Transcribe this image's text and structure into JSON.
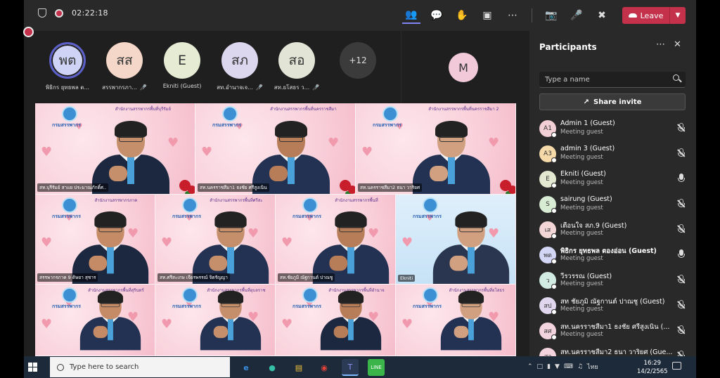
{
  "meeting": {
    "timer": "02:22:18",
    "leave_label": "Leave"
  },
  "avatars": [
    {
      "initials": "พต",
      "name": "พิธิกร ยุทธพล ต...",
      "color": "#cfd4f7",
      "selected": true,
      "mic_off": false
    },
    {
      "initials": "สส",
      "name": "สรรพากรภา...",
      "color": "#f4d7c8",
      "selected": false,
      "mic_off": true
    },
    {
      "initials": "E",
      "name": "Ekniti (Guest)",
      "color": "#e6ebd3",
      "selected": false,
      "mic_off": false
    },
    {
      "initials": "สภ",
      "name": "สท.อำนาจเจ...",
      "color": "#dcd7ef",
      "selected": false,
      "mic_off": true
    },
    {
      "initials": "สอ",
      "name": "สท.ยโสธร ว...",
      "color": "#e2e4d6",
      "selected": false,
      "mic_off": true
    }
  ],
  "overflow_count": "+12",
  "spotlight_initial": "M",
  "video_tiles": [
    {
      "header": "สำนักงานสรรพากรพื้นที่บุรีรัมย์",
      "caption": "สท.บุรีรัมย์ สาแย ประมาณภักดิ์ศ..",
      "blue": false
    },
    {
      "header": "สำนักงานสรรพากรพื้นที่นครราชสีมา",
      "caption": "สท.นครราชสีมา1 ธงชัย ศรีสูงเนิน",
      "blue": false
    },
    {
      "header": "สำนักงานสรรพากรพื้นที่นครราชสีมา 2",
      "caption": "สท.นครราชสีมา2 ธนา วาริยศ",
      "blue": false
    },
    {
      "header": "สำนักงานสรรพากรภาค",
      "caption": "สรรพากรภาค 9 ดิษยา สุชาร",
      "blue": false
    },
    {
      "header": "สำนักงานสรรพากรพื้นที่ศรีสะ",
      "caption": "สท.ศรีสะเกษ เจียรพรรณ์ จิตรัญญา",
      "blue": false
    },
    {
      "header": "สำนักงานสรรพากรพื้นที่",
      "caption": "สท.ชัยภูมิ ณัฐกานต์ ปาณชู",
      "blue": false
    },
    {
      "header": "",
      "caption": "Ekniti",
      "blue": true
    },
    {
      "header": "สำนักงานสรรพากรพื้นที่สุรินทร์",
      "caption": "",
      "blue": false
    },
    {
      "header": "สำนักงานสรรพากรพื้นที่อุบลราช",
      "caption": "",
      "blue": false
    },
    {
      "header": "สำนักงานสรรพากรพื้นที่อำนาจ",
      "caption": "",
      "blue": false
    },
    {
      "header": "สำนักงานสรรพากรพื้นที่ยโสธร",
      "caption": "",
      "blue": false
    }
  ],
  "tile_logo": "กรมสรรพากร",
  "panel": {
    "title": "Participants",
    "search_placeholder": "Type a name",
    "share_label": "Share invite"
  },
  "participants": [
    {
      "initials": "A1",
      "name": "Admin 1 (Guest)",
      "role": "Meeting guest",
      "color": "#f2cfd4",
      "mic": "off",
      "bold": false
    },
    {
      "initials": "A3",
      "name": "admin 3 (Guest)",
      "role": "Meeting guest",
      "color": "#f5d9a8",
      "mic": "off",
      "bold": false
    },
    {
      "initials": "E",
      "name": "Ekniti (Guest)",
      "role": "Meeting guest",
      "color": "#e3e8d0",
      "mic": "on",
      "bold": false
    },
    {
      "initials": "S",
      "name": "sairung (Guest)",
      "role": "Meeting guest",
      "color": "#d7ecd2",
      "mic": "off",
      "bold": false
    },
    {
      "initials": "เส",
      "name": "เตือนใจ สภ.9 (Guest)",
      "role": "Meeting guest",
      "color": "#f3d6d6",
      "mic": "off",
      "bold": false
    },
    {
      "initials": "พต",
      "name": "พิธิกร ยุทธพล ตองอ่อน (Guest)",
      "role": "Meeting guest",
      "color": "#d3d6f5",
      "mic": "on",
      "bold": true
    },
    {
      "initials": "ว",
      "name": "วีรวรรณ (Guest)",
      "role": "Meeting guest",
      "color": "#d2ebe2",
      "mic": "off",
      "bold": false
    },
    {
      "initials": "สป",
      "name": "สท ชัยภูมิ ณัฐกานต์ ปาณชู (Guest)",
      "role": "Meeting guest",
      "color": "#e0d7ee",
      "mic": "off",
      "bold": false
    },
    {
      "initials": "สศ",
      "name": "สท.นครราชสีมา1 ธงชัย ศรีสูงเนิน (...",
      "role": "Meeting guest",
      "color": "#f2d3de",
      "mic": "off",
      "bold": false
    },
    {
      "initials": "สว",
      "name": "สท.นครราชสีมา2 ธนา วาริยศ (Gue...",
      "role": "Meeting guest",
      "color": "#f2d3de",
      "mic": "off",
      "bold": false
    }
  ],
  "taskbar": {
    "search_placeholder": "Type here to search",
    "lang": "ไทย",
    "time": "16:29",
    "date": "14/2/2565"
  }
}
